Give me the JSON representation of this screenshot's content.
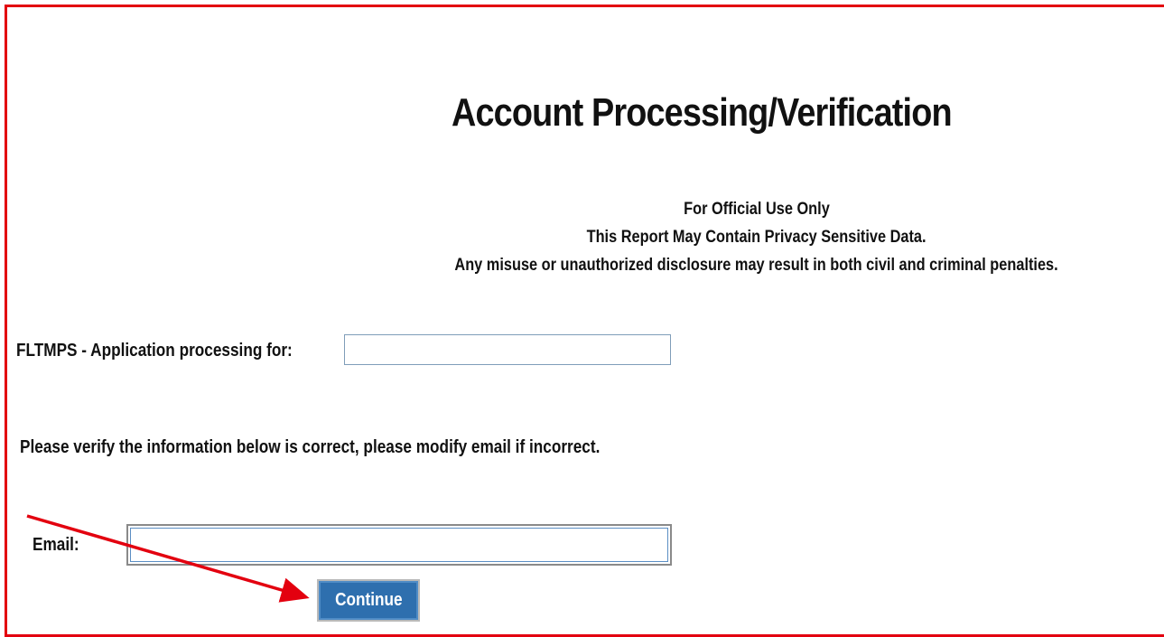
{
  "page": {
    "title": "Account Processing/Verification",
    "notice_lines": [
      "For Official Use Only",
      "This Report May Contain Privacy Sensitive Data.",
      "Any misuse or unauthorized disclosure may result in both civil and criminal penalties."
    ]
  },
  "form": {
    "application_label": "FLTMPS - Application processing for:",
    "application_value": "",
    "verify_instruction": "Please verify the information below is correct, please modify email if incorrect.",
    "email_label": "Email:",
    "email_value": "",
    "continue_label": "Continue"
  },
  "annotation": {
    "frame_color": "#e3000f",
    "arrow_color": "#e3000f",
    "arrow_target": "continue-button"
  },
  "colors": {
    "button_bg": "#2e6fae",
    "input_border": "#7f9db9"
  }
}
